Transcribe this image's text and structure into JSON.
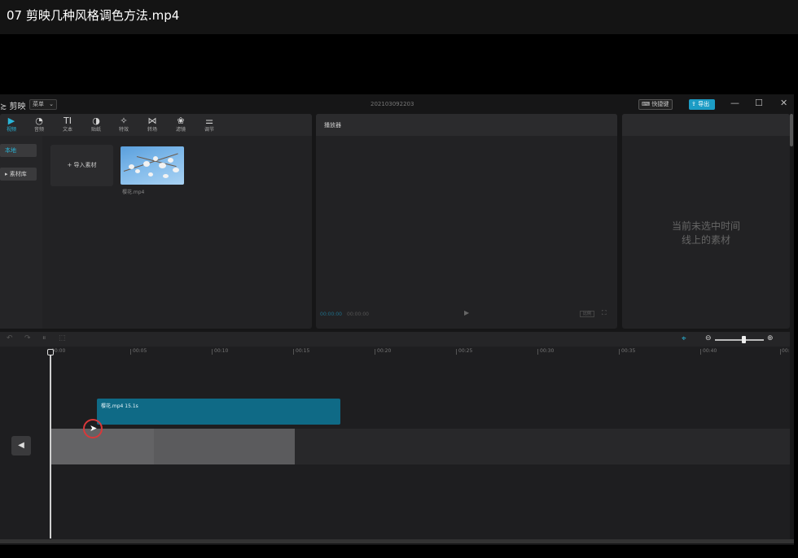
{
  "video_title": "07  剪映几种风格调色方法.mp4",
  "app": {
    "logo": "≿ 剪映",
    "menu_label": "菜单",
    "project_name": "202103092203",
    "shortcut_label": "⌨ 快捷键",
    "export_label": "⇪ 导出",
    "window_controls": {
      "minimize": "—",
      "maximize": "☐",
      "close": "✕"
    }
  },
  "toolbar": [
    {
      "glyph": "▶",
      "label": "视频",
      "icon": "video-icon",
      "active": true
    },
    {
      "glyph": "◔",
      "label": "音频",
      "icon": "audio-icon"
    },
    {
      "glyph": "TI",
      "label": "文本",
      "icon": "text-icon"
    },
    {
      "glyph": "◑",
      "label": "贴纸",
      "icon": "sticker-icon"
    },
    {
      "glyph": "✧",
      "label": "特效",
      "icon": "effects-icon"
    },
    {
      "glyph": "⋈",
      "label": "转场",
      "icon": "transition-icon"
    },
    {
      "glyph": "❀",
      "label": "滤镜",
      "icon": "filter-icon"
    },
    {
      "glyph": "⚌",
      "label": "调节",
      "icon": "adjust-icon"
    }
  ],
  "media": {
    "sidebar": [
      {
        "label": "本地",
        "active": true
      },
      {
        "label": "▸ 素材库"
      }
    ],
    "import_label": "+  导入素材",
    "file_name": "樱花.mp4"
  },
  "player": {
    "title": "播放器",
    "current_time": "00:00:00",
    "total_time": "00:00:00",
    "play_icon": "▶",
    "ratio_label": "比例",
    "fullscreen_icon": "⛶"
  },
  "inspector": {
    "empty_line1": "当前未选中时间",
    "empty_line2": "线上的素材"
  },
  "timeline": {
    "toolbar_icons": [
      "↶",
      "↷",
      "⏸",
      "⬚"
    ],
    "snap_icon": "⌖",
    "zoom_out": "⊖",
    "zoom_in": "⊕",
    "zoom_level": 0.55,
    "ticks": [
      "00:00",
      "00:05",
      "00:10",
      "00:15",
      "00:20",
      "00:25",
      "00:30",
      "00:35",
      "00:40",
      "00:"
    ],
    "clip_label": "樱花.mp4    15.1s",
    "track_button": "◀"
  },
  "colors": {
    "accent": "#2ab5d8",
    "clip": "#0f6a86",
    "cursor_ring": "#d9383a"
  }
}
